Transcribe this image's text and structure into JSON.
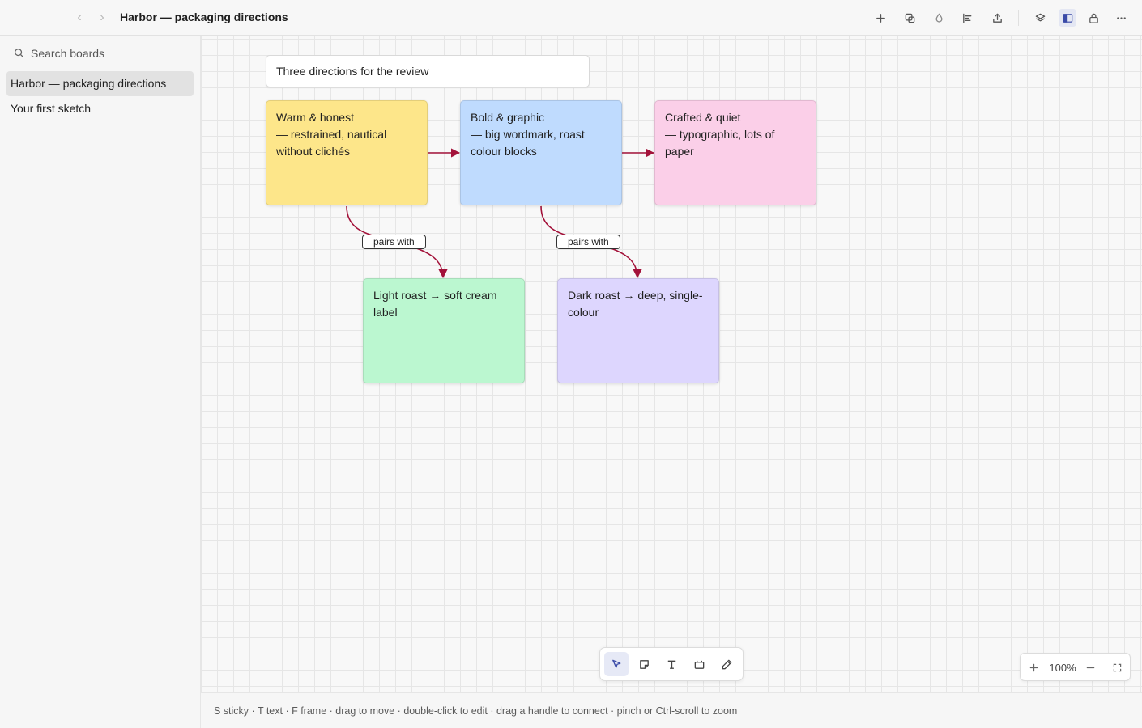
{
  "header": {
    "back_label": "‹",
    "forward_label": "›",
    "title": "Harbor — packaging directions",
    "toolbar_icons": [
      "plus-icon",
      "duplicate-icon",
      "fill-drop-icon",
      "align-left-icon",
      "share-icon",
      "layers-icon",
      "sidebar-toggle-icon",
      "lock-icon",
      "more-icon"
    ]
  },
  "sidebar": {
    "search_placeholder": "Search boards",
    "boards": [
      {
        "label": "Harbor — packaging directions",
        "selected": true
      },
      {
        "label": "Your first sketch",
        "selected": false
      }
    ]
  },
  "canvas": {
    "title_card": "Three directions for the review",
    "stickies": [
      {
        "text": "Warm & honest\n— restrained, nautical\nwithout clichés",
        "color": "#fde68a"
      },
      {
        "text": "Bold & graphic\n— big wordmark, roast\ncolour blocks",
        "color": "#bfdbfe"
      },
      {
        "text": "Crafted & quiet\n— typographic, lots of\npaper",
        "color": "#fbcfe8"
      },
      {
        "text": "Light roast → soft cream\nlabel",
        "color": "#bbf7d0"
      },
      {
        "text": "Dark roast → deep, single-\ncolour",
        "color": "#ddd6fe"
      }
    ],
    "edge_labels": [
      "pairs with",
      "pairs with"
    ],
    "connector_color": "#a3123a"
  },
  "tools": {
    "items": [
      "select-icon",
      "sticky-icon",
      "text-icon",
      "frame-icon",
      "pen-icon"
    ],
    "active": "select-icon"
  },
  "zoom": {
    "in_label": "+",
    "level": "100%",
    "out_label": "−"
  },
  "status": {
    "hint": "S sticky · T text · F frame · drag to move · double-click to edit · drag a handle to connect · pinch or Ctrl-scroll to zoom"
  }
}
